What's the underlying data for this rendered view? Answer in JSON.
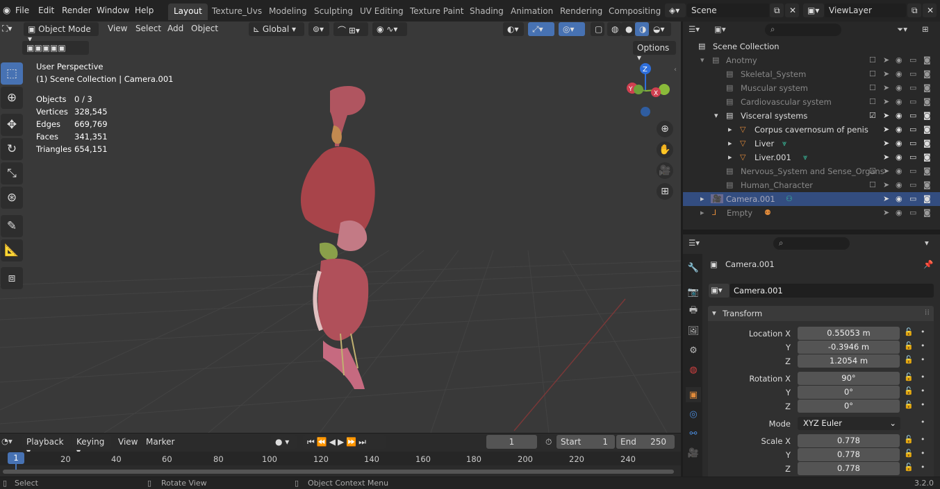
{
  "menubar": {
    "menus": [
      "File",
      "Edit",
      "Render",
      "Window",
      "Help"
    ],
    "workspaces": [
      "Layout",
      "Texture_Uvs",
      "Modeling",
      "Sculpting",
      "UV Editing",
      "Texture Paint",
      "Shading",
      "Animation",
      "Rendering",
      "Compositing"
    ],
    "active_workspace": "Layout",
    "scene": "Scene",
    "view_layer": "ViewLayer"
  },
  "viewport_header": {
    "mode": "Object Mode",
    "menus": [
      "View",
      "Select",
      "Add",
      "Object"
    ],
    "orientation": "Global",
    "options": "Options"
  },
  "viewport": {
    "perspective": "User Perspective",
    "collection_line": "(1) Scene Collection | Camera.001",
    "stats": [
      {
        "label": "Objects",
        "value": "0 / 3"
      },
      {
        "label": "Vertices",
        "value": "328,545"
      },
      {
        "label": "Edges",
        "value": "669,769"
      },
      {
        "label": "Faces",
        "value": "341,351"
      },
      {
        "label": "Triangles",
        "value": "654,151"
      }
    ],
    "gizmo": {
      "z": "Z",
      "y": "Y",
      "x": "X"
    }
  },
  "outliner": {
    "rows": [
      {
        "label": "Scene Collection",
        "indent": 0,
        "dim": false
      },
      {
        "label": "Anotmy",
        "indent": 1,
        "dim": true
      },
      {
        "label": "Skeletal_System",
        "indent": 2,
        "dim": true
      },
      {
        "label": "Muscular system",
        "indent": 2,
        "dim": true
      },
      {
        "label": "Cardiovascular system",
        "indent": 2,
        "dim": true
      },
      {
        "label": "Visceral systems",
        "indent": 2,
        "dim": false
      },
      {
        "label": "Corpus cavernosum of penis",
        "indent": 3,
        "dim": false
      },
      {
        "label": "Liver",
        "indent": 3,
        "dim": false
      },
      {
        "label": "Liver.001",
        "indent": 3,
        "dim": false
      },
      {
        "label": "Nervous_System and Sense_Organs",
        "indent": 2,
        "dim": true
      },
      {
        "label": "Human_Character",
        "indent": 2,
        "dim": true
      },
      {
        "label": "Camera.001",
        "indent": 1,
        "dim": false
      },
      {
        "label": "Empty",
        "indent": 1,
        "dim": true
      }
    ]
  },
  "properties": {
    "object_name": "Camera.001",
    "data_name": "Camera.001",
    "panel": "Transform",
    "location": {
      "label": "Location X",
      "x": "0.55053 m",
      "y": "-0.3946 m",
      "z": "1.2054 m"
    },
    "rotation": {
      "label": "Rotation X",
      "x": "90°",
      "y": "0°",
      "z": "0°"
    },
    "mode": {
      "label": "Mode",
      "value": "XYZ Euler"
    },
    "scale": {
      "label": "Scale X",
      "x": "0.778",
      "y": "0.778",
      "z": "0.778"
    },
    "axis_y": "Y",
    "axis_z": "Z"
  },
  "timeline": {
    "menus": [
      "Playback",
      "Keying",
      "View",
      "Marker"
    ],
    "current_frame": "1",
    "start_label": "Start",
    "start": "1",
    "end_label": "End",
    "end": "250",
    "ticks": [
      "1",
      "20",
      "40",
      "60",
      "80",
      "100",
      "120",
      "140",
      "160",
      "180",
      "200",
      "220",
      "240"
    ]
  },
  "statusbar": {
    "select": "Select",
    "rotate": "Rotate View",
    "context": "Object Context Menu",
    "version": "3.2.0"
  },
  "colors": {
    "accent": "#4772b3",
    "selected_row": "#334d80",
    "bg": "#393939"
  }
}
